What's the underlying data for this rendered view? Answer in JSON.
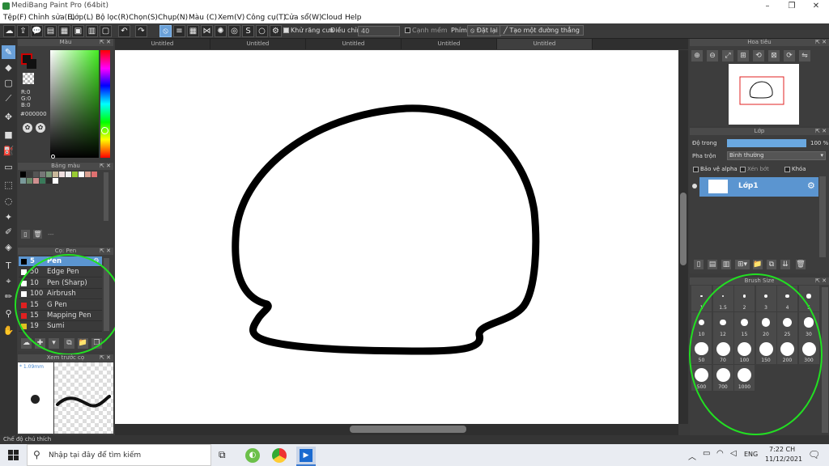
{
  "window": {
    "title": "MediBang Paint Pro (64bit)"
  },
  "menu": [
    "Tệp(F)",
    "Chỉnh sửa(E)",
    "Lớp(L)",
    "Bộ lọc(R)",
    "Chọn(S)",
    "Chụp(N)",
    "Màu (C)",
    "Xem(V)",
    "Công cụ(T)",
    "Cửa sổ(W)",
    "Cloud",
    "Help"
  ],
  "toolbar": {
    "antialias_label": "Khử răng cưa",
    "adjust_label": "Điều chỉnh",
    "adjust_value": "40",
    "edge_label": "Cạnh mềm",
    "key_label": "Phím",
    "reset_label": "Đặt lại",
    "straight_label": "Tạo một đường thẳng"
  },
  "color_panel": {
    "title": "Màu",
    "r": "R:0",
    "g": "G:0",
    "b": "B:0",
    "hex": "#000000",
    "primary": "#000000",
    "accent": "#cc0000"
  },
  "palette_panel": {
    "title": "Bảng màu",
    "footer": "---",
    "colors": [
      "#000000",
      "#3a3a3a",
      "#555555",
      "#777777",
      "#7a9a7a",
      "#c8b89a",
      "#f0e0e0",
      "#f0f0f0",
      "#99cc33",
      "#ffffff",
      "#d9a090",
      "#e07070",
      "#7a9a9a",
      "#6a8a6a",
      "#d09090",
      "#3a7a5a",
      "#2a2a2a",
      "#ffffff"
    ]
  },
  "brush_panel": {
    "title": "Cọ: Pen",
    "items": [
      {
        "size": "5",
        "name": "Pen",
        "color": "#000000",
        "selected": true
      },
      {
        "size": "50",
        "name": "Edge Pen",
        "color": "#ffffff"
      },
      {
        "size": "10",
        "name": "Pen (Sharp)",
        "color": "#ffffff"
      },
      {
        "size": "100",
        "name": "Airbrush",
        "color": "#ffffff"
      },
      {
        "size": "15",
        "name": "G Pen",
        "color": "#e02020"
      },
      {
        "size": "15",
        "name": "Mapping Pen",
        "color": "#e02020"
      },
      {
        "size": "19",
        "name": "Sumi",
        "color": "#e0c020"
      }
    ]
  },
  "preview_panel": {
    "title": "Xem trước cọ",
    "size": "1.09mm"
  },
  "tabs": [
    "Untitled",
    "Untitled",
    "Untitled",
    "Untitled",
    "Untitled",
    "Untitled"
  ],
  "navigator": {
    "title": "Hoa tiêu"
  },
  "layer_panel": {
    "title": "Lớp",
    "opacity_label": "Độ trong",
    "opacity_value": "100 %",
    "opacity": 1.0,
    "blend_label": "Pha trộn",
    "blend_value": "Bình thường",
    "protect_alpha": "Bảo vệ alpha",
    "clipping": "Xén bớt",
    "lock": "Khóa",
    "layer_name": "Lớp1"
  },
  "brush_size": {
    "title": "Brush Size",
    "sizes": [
      "1",
      "1.5",
      "2",
      "3",
      "4",
      "5",
      "10",
      "12",
      "15",
      "20",
      "25",
      "30",
      "50",
      "70",
      "100",
      "150",
      "200",
      "300",
      "500",
      "700",
      "1000"
    ]
  },
  "statusbar": {
    "text": "Chế độ chú thích"
  },
  "taskbar": {
    "search_placeholder": "Nhập tại đây để tìm kiếm",
    "lang": "ENG",
    "time": "7:22 CH",
    "date": "11/12/2021"
  }
}
